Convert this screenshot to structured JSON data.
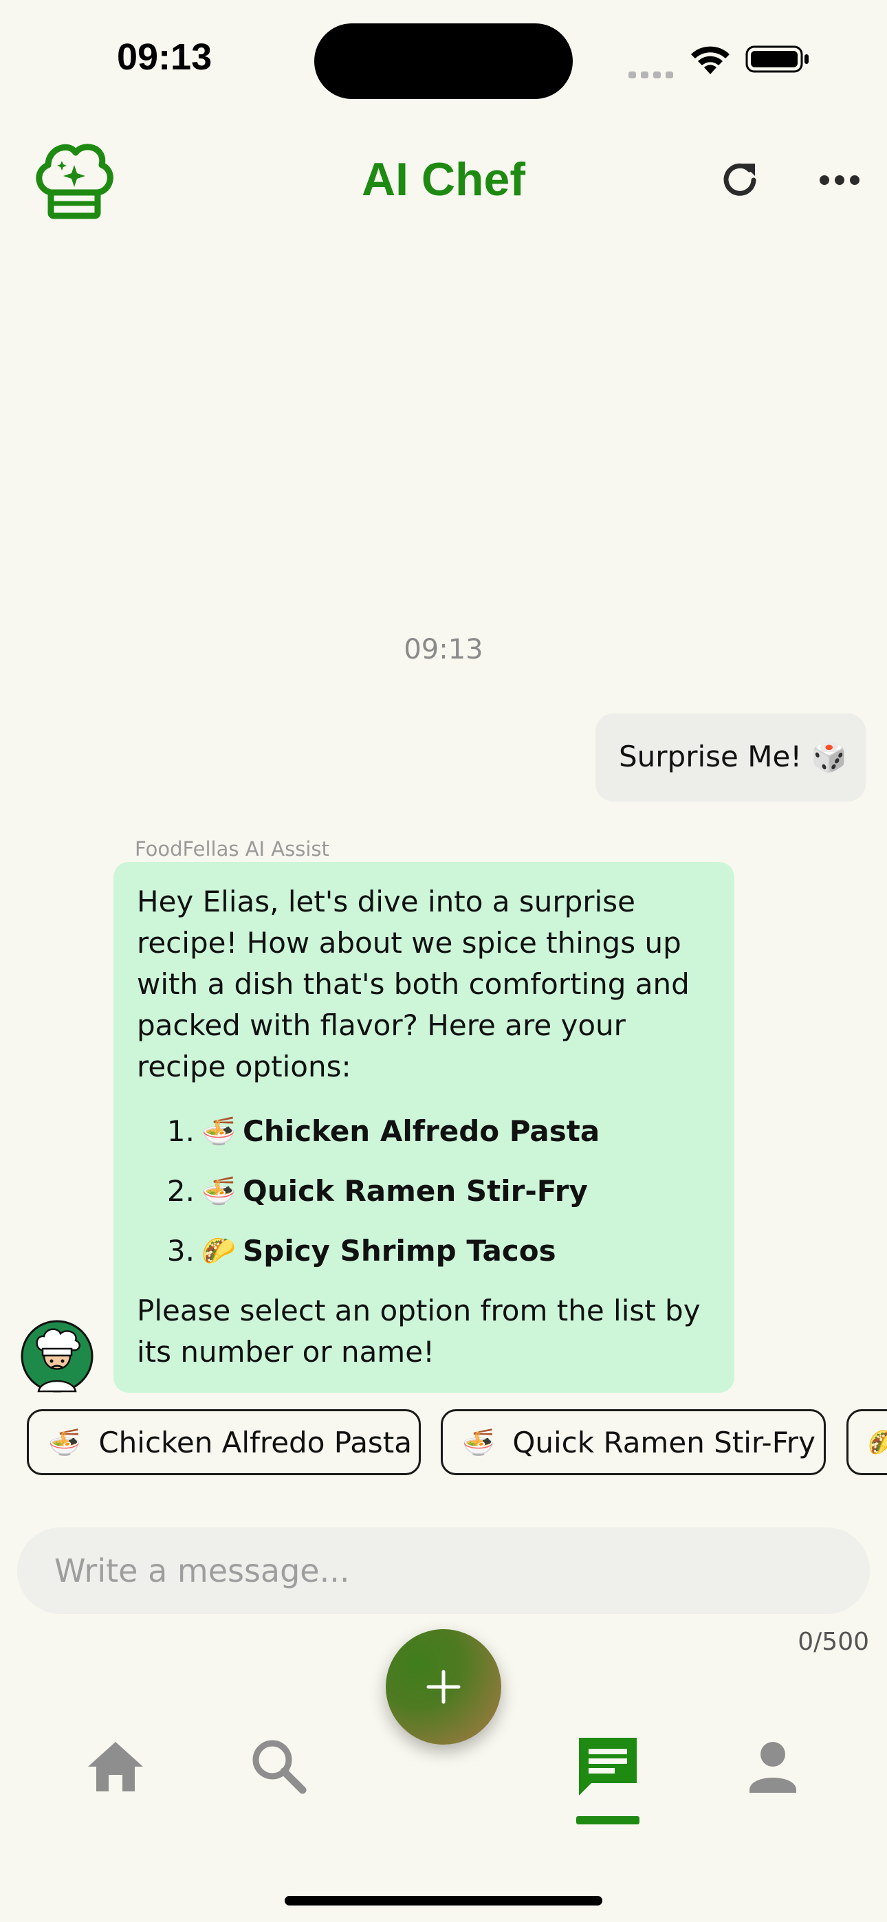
{
  "status_bar": {
    "time": "09:13"
  },
  "header": {
    "title": "AI Chef",
    "logo_icon": "chef-hat-sparkle-icon",
    "refresh_icon": "refresh-icon",
    "more_icon": "more-horizontal-icon",
    "accent_color": "#1e8a12"
  },
  "chat": {
    "timestamp": "09:13",
    "user_message": "Surprise Me! 🎲",
    "bot_sender": "FoodFellas AI Assist",
    "bot_intro": "Hey Elias, let's dive into a surprise recipe! How about we spice things up with a dish that's both comforting and packed with flavor? Here are your recipe options:",
    "options": [
      {
        "number": "1.",
        "emoji": "🍜",
        "name": "Chicken Alfredo Pasta"
      },
      {
        "number": "2.",
        "emoji": "🍜",
        "name": "Quick Ramen Stir-Fry"
      },
      {
        "number": "3.",
        "emoji": "🌮",
        "name": "Spicy Shrimp Tacos"
      }
    ],
    "bot_outro": "Please select an option from the list by its number or name!",
    "bot_bubble_color": "#cdf6d9"
  },
  "quick_replies": [
    {
      "emoji": "🍜",
      "label": "Chicken Alfredo Pasta"
    },
    {
      "emoji": "🍜",
      "label": "Quick Ramen Stir-Fry"
    },
    {
      "emoji": "🌮",
      "label": ""
    }
  ],
  "composer": {
    "placeholder": "Write a message...",
    "char_count": "0/500"
  },
  "fab": {
    "icon": "plus-icon"
  },
  "nav": {
    "items": [
      {
        "icon": "home-icon",
        "active": false
      },
      {
        "icon": "search-icon",
        "active": false
      },
      {
        "icon": "chat-icon",
        "active": true
      },
      {
        "icon": "profile-icon",
        "active": false
      }
    ]
  }
}
